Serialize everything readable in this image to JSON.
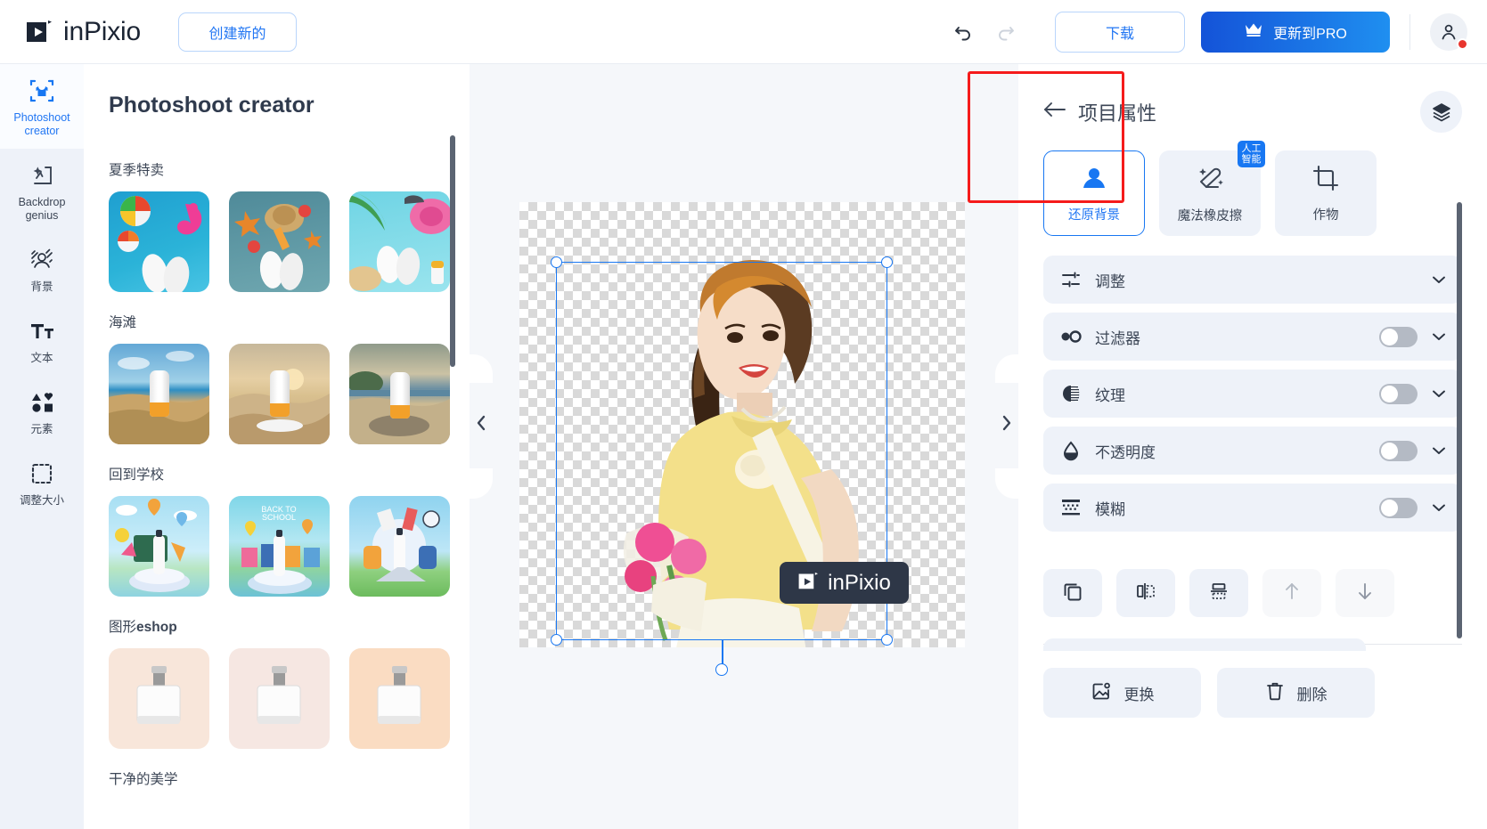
{
  "header": {
    "brand": "inPixio",
    "brand_icon": "play-logo-icon",
    "create_new_label": "创建新的",
    "undo_icon": "undo-arrow-icon",
    "redo_icon": "redo-arrow-icon",
    "download_label": "下载",
    "pro_label": "更新到PRO",
    "pro_icon": "crown-icon",
    "avatar_icon": "user-avatar-icon",
    "accent_blue": "#2176f3",
    "pro_gradient_from": "#1453d8",
    "pro_gradient_to": "#1f8ff0"
  },
  "rail": {
    "items": [
      {
        "label": "Photoshoot creator",
        "icon": "tshirt-frame-icon",
        "active": true
      },
      {
        "label": "Backdrop genius",
        "icon": "backdrop-frame-icon",
        "active": false
      },
      {
        "label": "背景",
        "icon": "background-portrait-icon",
        "active": false
      },
      {
        "label": "文本",
        "icon": "text-tt-icon",
        "active": false
      },
      {
        "label": "元素",
        "icon": "shapes-elements-icon",
        "active": false
      },
      {
        "label": "调整大小",
        "icon": "resize-dashed-icon",
        "active": false
      }
    ]
  },
  "templates": {
    "title": "Photoshoot creator",
    "groups": [
      {
        "name": "夏季特卖",
        "style": "summer"
      },
      {
        "name": "海滩",
        "style": "beach"
      },
      {
        "name": "回到学校",
        "style": "school"
      },
      {
        "name": "图形eshop",
        "style": "eshop"
      },
      {
        "name": "干净的美学",
        "style": "clean"
      }
    ]
  },
  "canvas": {
    "watermark_text": "inPixio",
    "watermark_icon": "play-logo-icon",
    "collapse_left_icon": "chevron-left-icon",
    "collapse_right_icon": "chevron-right-icon",
    "selection_border_color": "#1877f2"
  },
  "right_panel": {
    "back_icon": "arrow-left-icon",
    "title": "项目属性",
    "layers_icon": "layers-stack-icon",
    "tools": [
      {
        "label": "还原背景",
        "icon": "person-restore-icon",
        "selected": true,
        "badge": null
      },
      {
        "label": "魔法橡皮擦",
        "icon": "magic-eraser-icon",
        "selected": false,
        "badge": "人工智能"
      },
      {
        "label": "作物",
        "icon": "crop-icon",
        "selected": false,
        "badge": null
      }
    ],
    "highlight_color": "#f51b1b",
    "properties": [
      {
        "label": "调整",
        "icon": "sliders-icon",
        "toggle": false,
        "chevron": true
      },
      {
        "label": "过滤器",
        "icon": "filter-dots-icon",
        "toggle": true,
        "toggle_on": false,
        "chevron": true
      },
      {
        "label": "纹理",
        "icon": "texture-contrast-icon",
        "toggle": true,
        "toggle_on": false,
        "chevron": true
      },
      {
        "label": "不透明度",
        "icon": "opacity-drop-icon",
        "toggle": true,
        "toggle_on": false,
        "chevron": true
      },
      {
        "label": "模糊",
        "icon": "blur-grid-icon",
        "toggle": true,
        "toggle_on": false,
        "chevron": true
      }
    ],
    "align_buttons": [
      {
        "icon": "duplicate-icon",
        "dim": false
      },
      {
        "icon": "flip-horizontal-icon",
        "dim": false
      },
      {
        "icon": "flip-vertical-icon",
        "dim": false
      },
      {
        "icon": "move-up-icon",
        "dim": true
      },
      {
        "icon": "move-down-icon",
        "dim": false
      }
    ],
    "bottom_buttons": [
      {
        "label": "更换",
        "icon": "replace-image-icon"
      },
      {
        "label": "删除",
        "icon": "trash-icon"
      }
    ]
  }
}
